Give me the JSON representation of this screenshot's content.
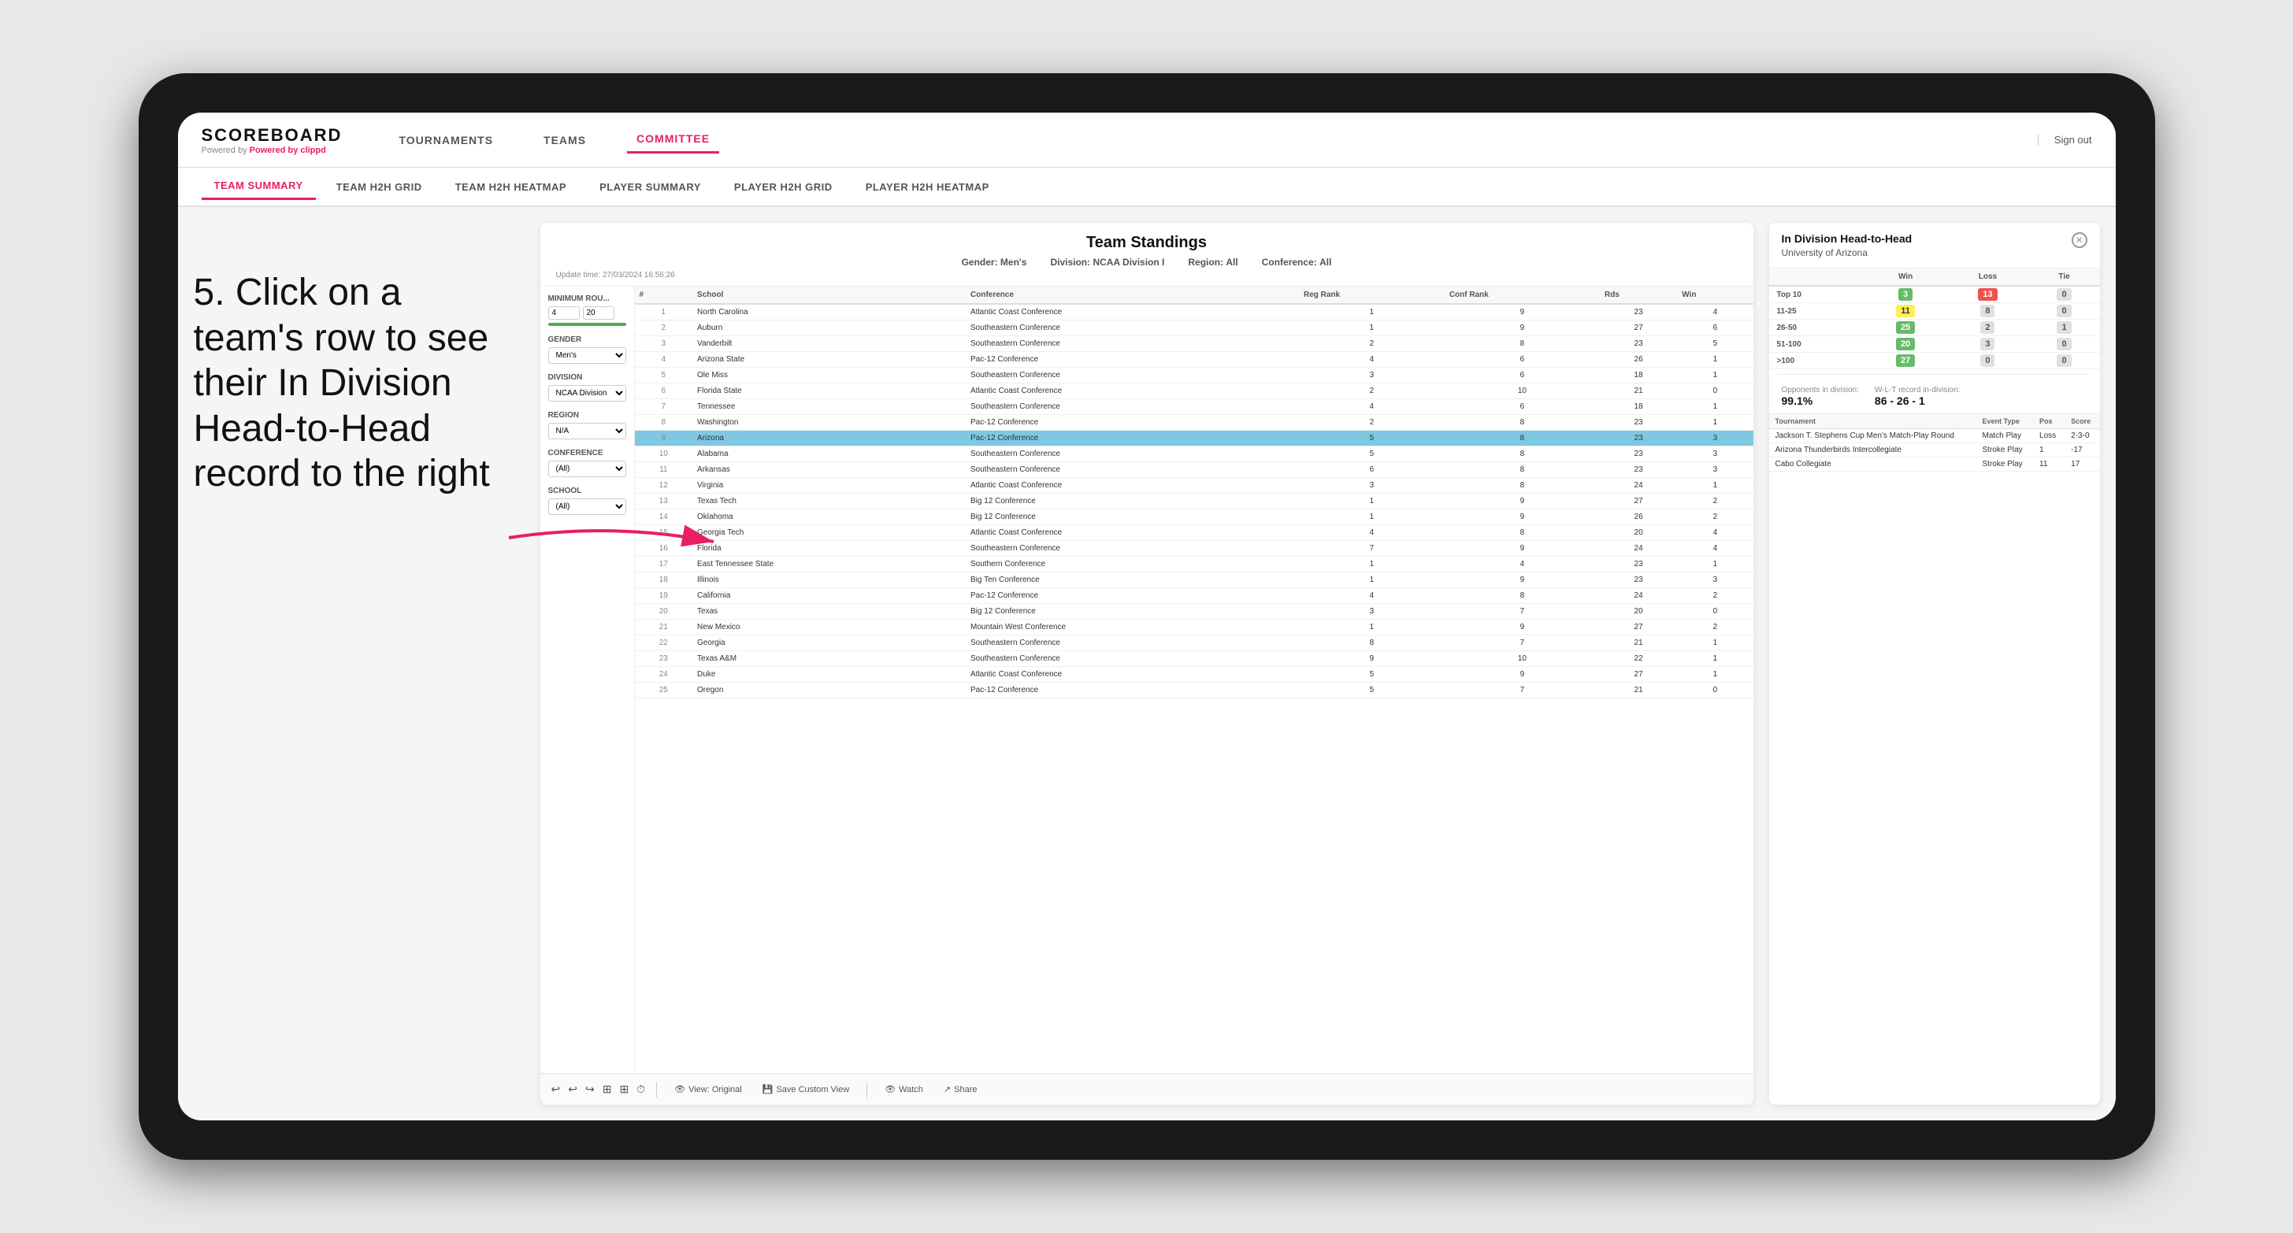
{
  "app": {
    "logo": "SCOREBOARD",
    "logo_sub": "Powered by clippd",
    "sign_out": "Sign out"
  },
  "nav": {
    "items": [
      {
        "label": "TOURNAMENTS",
        "active": false
      },
      {
        "label": "TEAMS",
        "active": false
      },
      {
        "label": "COMMITTEE",
        "active": true
      }
    ]
  },
  "sub_nav": {
    "items": [
      {
        "label": "TEAM SUMMARY",
        "active": true
      },
      {
        "label": "TEAM H2H GRID",
        "active": false
      },
      {
        "label": "TEAM H2H HEATMAP",
        "active": false
      },
      {
        "label": "PLAYER SUMMARY",
        "active": false
      },
      {
        "label": "PLAYER H2H GRID",
        "active": false
      },
      {
        "label": "PLAYER H2H HEATMAP",
        "active": false
      }
    ]
  },
  "annotation": {
    "text": "5. Click on a team's row to see their In Division Head-to-Head record to the right"
  },
  "panel": {
    "title": "Team Standings",
    "update_label": "Update time:",
    "update_time": "27/03/2024 16:56:26",
    "gender_label": "Gender:",
    "gender_value": "Men's",
    "division_label": "Division:",
    "division_value": "NCAA Division I",
    "region_label": "Region:",
    "region_value": "All",
    "conference_label": "Conference:",
    "conference_value": "All"
  },
  "filters": {
    "min_rounds_label": "Minimum Rou...",
    "min_val": "4",
    "max_val": "20",
    "gender_label": "Gender",
    "gender_value": "Men's",
    "division_label": "Division",
    "division_value": "NCAA Division I",
    "region_label": "Region",
    "region_value": "N/A",
    "conference_label": "Conference",
    "conference_value": "(All)",
    "school_label": "School",
    "school_value": "(All)"
  },
  "table": {
    "headers": [
      "#",
      "School",
      "Conference",
      "Reg Rank",
      "Conf Rank",
      "Rds",
      "Win"
    ],
    "rows": [
      {
        "rank": 1,
        "school": "North Carolina",
        "conference": "Atlantic Coast Conference",
        "reg_rank": 1,
        "conf_rank": 9,
        "rds": 23,
        "win": 4
      },
      {
        "rank": 2,
        "school": "Auburn",
        "conference": "Southeastern Conference",
        "reg_rank": 1,
        "conf_rank": 9,
        "rds": 27,
        "win": 6
      },
      {
        "rank": 3,
        "school": "Vanderbilt",
        "conference": "Southeastern Conference",
        "reg_rank": 2,
        "conf_rank": 8,
        "rds": 23,
        "win": 5
      },
      {
        "rank": 4,
        "school": "Arizona State",
        "conference": "Pac-12 Conference",
        "reg_rank": 4,
        "conf_rank": 6,
        "rds": 26,
        "win": 1
      },
      {
        "rank": 5,
        "school": "Ole Miss",
        "conference": "Southeastern Conference",
        "reg_rank": 3,
        "conf_rank": 6,
        "rds": 18,
        "win": 1
      },
      {
        "rank": 6,
        "school": "Florida State",
        "conference": "Atlantic Coast Conference",
        "reg_rank": 2,
        "conf_rank": 10,
        "rds": 21,
        "win": 0
      },
      {
        "rank": 7,
        "school": "Tennessee",
        "conference": "Southeastern Conference",
        "reg_rank": 4,
        "conf_rank": 6,
        "rds": 18,
        "win": 1
      },
      {
        "rank": 8,
        "school": "Washington",
        "conference": "Pac-12 Conference",
        "reg_rank": 2,
        "conf_rank": 8,
        "rds": 23,
        "win": 1
      },
      {
        "rank": 9,
        "school": "Arizona",
        "conference": "Pac-12 Conference",
        "reg_rank": 5,
        "conf_rank": 8,
        "rds": 23,
        "win": 3,
        "selected": true
      },
      {
        "rank": 10,
        "school": "Alabama",
        "conference": "Southeastern Conference",
        "reg_rank": 5,
        "conf_rank": 8,
        "rds": 23,
        "win": 3
      },
      {
        "rank": 11,
        "school": "Arkansas",
        "conference": "Southeastern Conference",
        "reg_rank": 6,
        "conf_rank": 8,
        "rds": 23,
        "win": 3
      },
      {
        "rank": 12,
        "school": "Virginia",
        "conference": "Atlantic Coast Conference",
        "reg_rank": 3,
        "conf_rank": 8,
        "rds": 24,
        "win": 1
      },
      {
        "rank": 13,
        "school": "Texas Tech",
        "conference": "Big 12 Conference",
        "reg_rank": 1,
        "conf_rank": 9,
        "rds": 27,
        "win": 2
      },
      {
        "rank": 14,
        "school": "Oklahoma",
        "conference": "Big 12 Conference",
        "reg_rank": 1,
        "conf_rank": 9,
        "rds": 26,
        "win": 2
      },
      {
        "rank": 15,
        "school": "Georgia Tech",
        "conference": "Atlantic Coast Conference",
        "reg_rank": 4,
        "conf_rank": 8,
        "rds": 20,
        "win": 4
      },
      {
        "rank": 16,
        "school": "Florida",
        "conference": "Southeastern Conference",
        "reg_rank": 7,
        "conf_rank": 9,
        "rds": 24,
        "win": 4
      },
      {
        "rank": 17,
        "school": "East Tennessee State",
        "conference": "Southern Conference",
        "reg_rank": 1,
        "conf_rank": 4,
        "rds": 23,
        "win": 1
      },
      {
        "rank": 18,
        "school": "Illinois",
        "conference": "Big Ten Conference",
        "reg_rank": 1,
        "conf_rank": 9,
        "rds": 23,
        "win": 3
      },
      {
        "rank": 19,
        "school": "California",
        "conference": "Pac-12 Conference",
        "reg_rank": 4,
        "conf_rank": 8,
        "rds": 24,
        "win": 2
      },
      {
        "rank": 20,
        "school": "Texas",
        "conference": "Big 12 Conference",
        "reg_rank": 3,
        "conf_rank": 7,
        "rds": 20,
        "win": 0
      },
      {
        "rank": 21,
        "school": "New Mexico",
        "conference": "Mountain West Conference",
        "reg_rank": 1,
        "conf_rank": 9,
        "rds": 27,
        "win": 2
      },
      {
        "rank": 22,
        "school": "Georgia",
        "conference": "Southeastern Conference",
        "reg_rank": 8,
        "conf_rank": 7,
        "rds": 21,
        "win": 1
      },
      {
        "rank": 23,
        "school": "Texas A&M",
        "conference": "Southeastern Conference",
        "reg_rank": 9,
        "conf_rank": 10,
        "rds": 22,
        "win": 1
      },
      {
        "rank": 24,
        "school": "Duke",
        "conference": "Atlantic Coast Conference",
        "reg_rank": 5,
        "conf_rank": 9,
        "rds": 27,
        "win": 1
      },
      {
        "rank": 25,
        "school": "Oregon",
        "conference": "Pac-12 Conference",
        "reg_rank": 5,
        "conf_rank": 7,
        "rds": 21,
        "win": 0
      }
    ]
  },
  "h2h_panel": {
    "title": "In Division Head-to-Head",
    "team": "University of Arizona",
    "win_label": "Win",
    "loss_label": "Loss",
    "tie_label": "Tie",
    "rows": [
      {
        "range": "Top 10",
        "win": 3,
        "win_color": "green",
        "loss": 13,
        "loss_color": "red",
        "tie": 0,
        "tie_color": "gray"
      },
      {
        "range": "11-25",
        "win": 11,
        "win_color": "yellow",
        "loss": 8,
        "loss_color": "gray",
        "tie": 0,
        "tie_color": "gray"
      },
      {
        "range": "26-50",
        "win": 25,
        "win_color": "green",
        "loss": 2,
        "loss_color": "gray",
        "tie": 1,
        "tie_color": "gray"
      },
      {
        "range": "51-100",
        "win": 20,
        "win_color": "green",
        "loss": 3,
        "loss_color": "gray",
        "tie": 0,
        "tie_color": "gray"
      },
      {
        "range": ">100",
        "win": 27,
        "win_color": "green",
        "loss": 0,
        "loss_color": "gray",
        "tie": 0,
        "tie_color": "gray"
      }
    ],
    "opponents_label": "Opponents in division:",
    "opponents_value": "99.1%",
    "record_label": "W-L-T record in-division:",
    "record_value": "86 - 26 - 1",
    "tournaments": [
      {
        "name": "Jackson T. Stephens Cup Men's Match-Play Round",
        "event_type": "Match Play",
        "pos": "Loss",
        "score": "2-3-0"
      },
      {
        "name": "Arizona Thunderbirds Intercollegiate",
        "event_type": "Stroke Play",
        "pos": "1",
        "score": "-17"
      },
      {
        "name": "Cabo Collegiate",
        "event_type": "Stroke Play",
        "pos": "11",
        "score": "17"
      }
    ],
    "tournament_headers": [
      "Tournament",
      "Event Type",
      "Pos",
      "Score"
    ]
  },
  "toolbar": {
    "undo": "↩",
    "redo": "↪",
    "view_original": "View: Original",
    "save_custom": "Save Custom View",
    "watch": "Watch",
    "share": "Share"
  }
}
